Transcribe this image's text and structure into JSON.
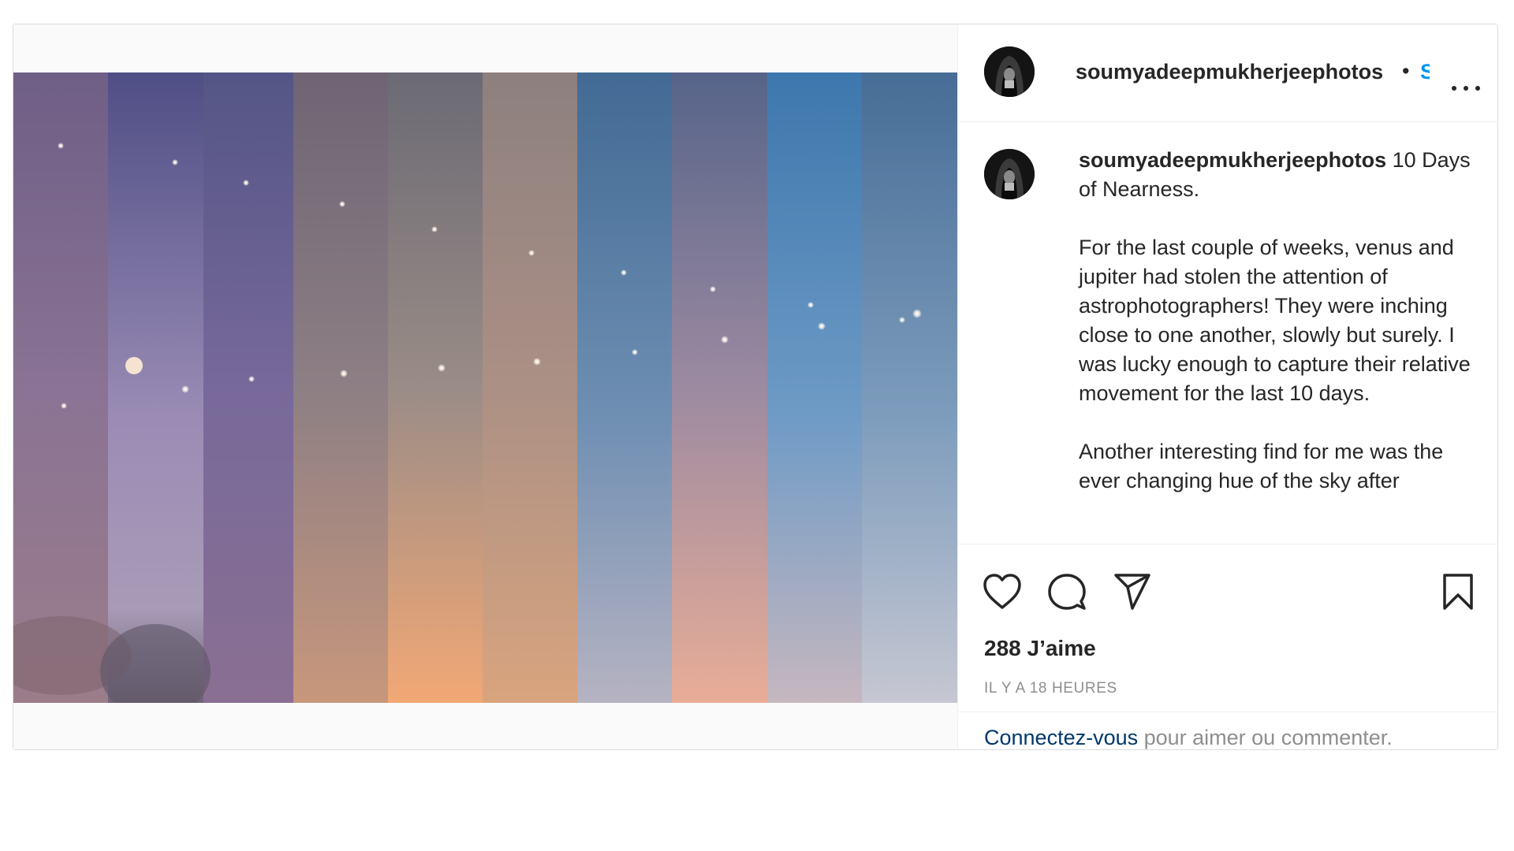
{
  "post": {
    "header": {
      "username": "soumyadeepmukherjeephotos",
      "separator": "•",
      "follow_label": "S"
    },
    "caption": {
      "username": "soumyadeepmukherjeephotos",
      "title": "10 Days of Nearness.",
      "paragraph_1": "For the last couple of weeks, venus and jupiter had stolen the attention of astrophotographers! They were inching close to one another, slowly but surely. I was lucky enough to capture their relative movement for the last 10 days.",
      "paragraph_2": "Another interesting find for me was the ever changing hue of the sky after"
    },
    "likes": "288 J’aime",
    "timestamp": "IL Y A 18 HEURES",
    "login": {
      "link": "Connectez-vous",
      "rest": " pour aimer ou commenter."
    }
  },
  "icons": {
    "like": "heart-icon",
    "comment": "comment-bubble-icon",
    "share": "paper-plane-icon",
    "save": "bookmark-icon",
    "more": "more-dots-icon"
  },
  "colors": {
    "link_blue": "#00376b",
    "follow_blue": "#0095f6",
    "text": "#262626",
    "muted": "#8e8e8e",
    "border": "#dbdbdb"
  }
}
